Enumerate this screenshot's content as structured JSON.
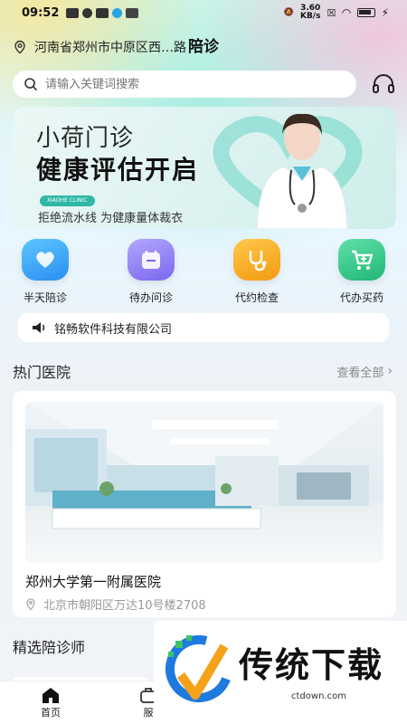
{
  "status_bar": {
    "time": "09:52",
    "net_speed": "3.60\nKB/s"
  },
  "header": {
    "title": "陪诊",
    "location": "河南省郑州市中原区西…路"
  },
  "search": {
    "placeholder": "请输入关键词搜索"
  },
  "banner": {
    "line1": "小荷门诊",
    "line2": "健康评估开启",
    "badge": "XIAOHE CLINIC",
    "subtitle": "拒绝流水线 为健康量体裁衣"
  },
  "services": [
    {
      "label": "半天陪诊",
      "icon": "heart-hands-icon",
      "color": "#3aa8f0"
    },
    {
      "label": "待办问诊",
      "icon": "calendar-icon",
      "color": "#8a7cf0"
    },
    {
      "label": "代约检查",
      "icon": "stethoscope-icon",
      "color": "#f6a21a"
    },
    {
      "label": "代办买药",
      "icon": "cart-icon",
      "color": "#2fc48a"
    }
  ],
  "notice": {
    "text": "铭畅软件科技有限公司"
  },
  "hot_hospitals": {
    "title": "热门医院",
    "more": "查看全部",
    "items": [
      {
        "name": "郑州大学第一附属医院",
        "address": "北京市朝阳区万达10号楼2708"
      }
    ]
  },
  "escorts": {
    "title": "精选陪诊师"
  },
  "tabbar": {
    "home": "首页",
    "service": "服"
  },
  "ad": {
    "title": "传统下载",
    "url": "ctdown.com"
  }
}
